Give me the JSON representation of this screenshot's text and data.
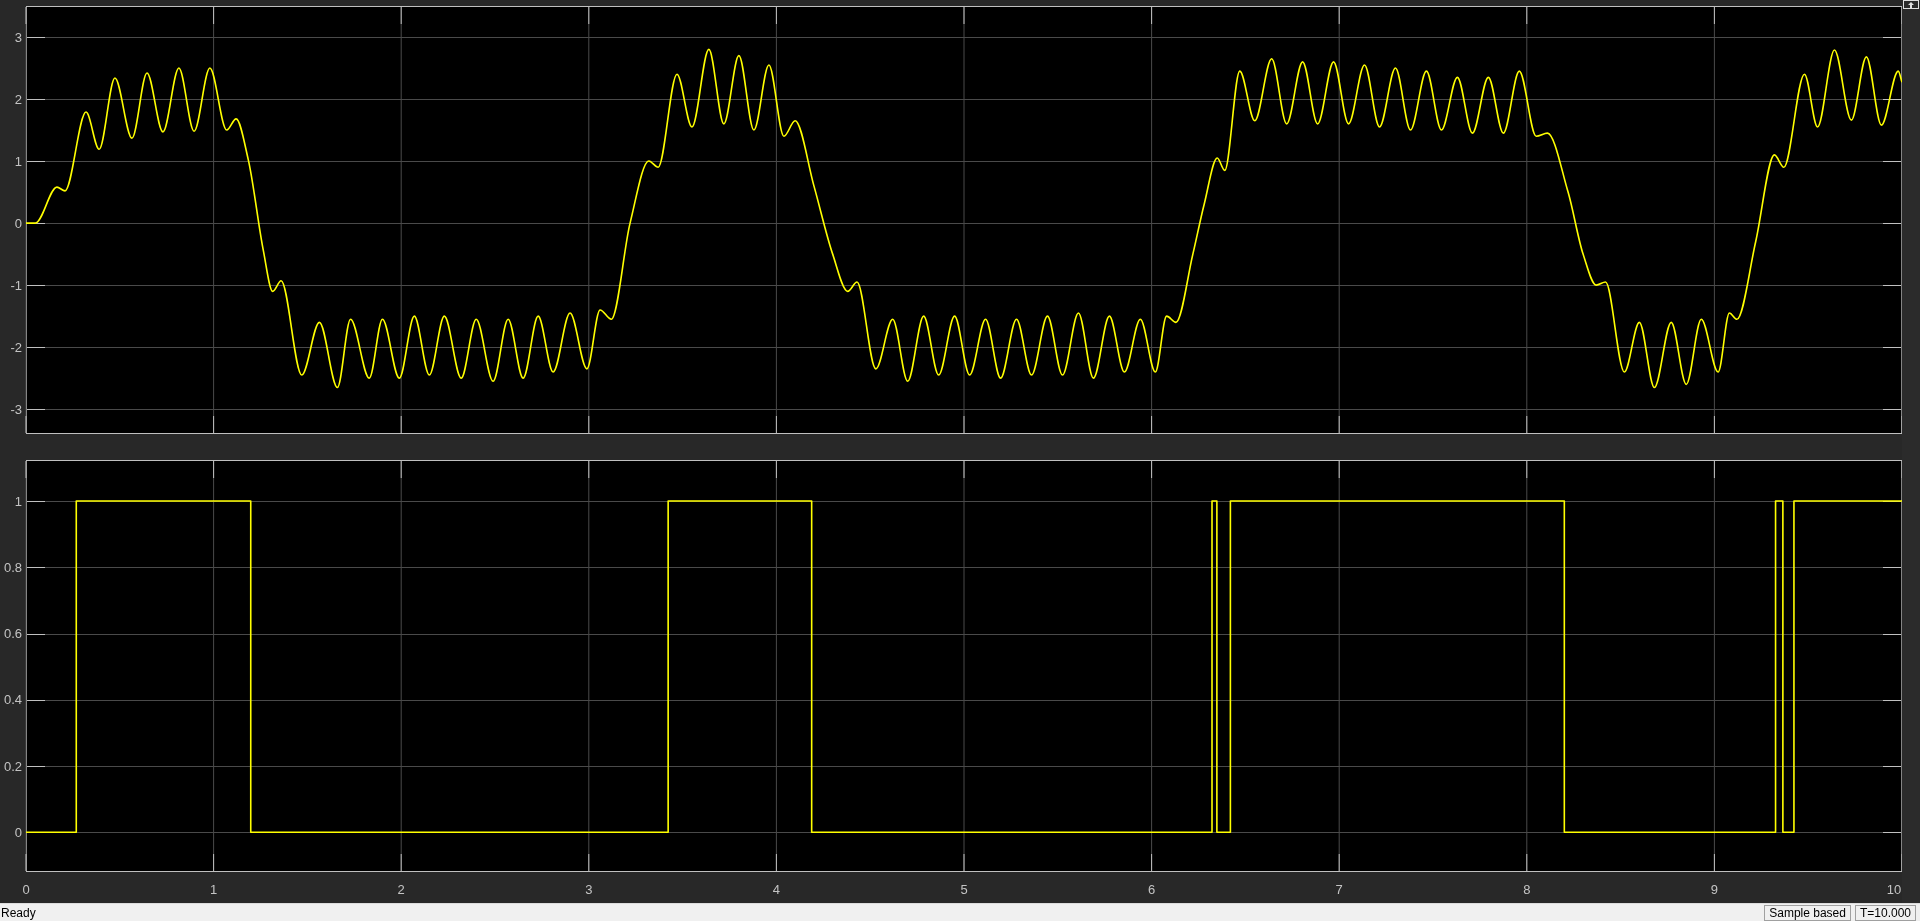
{
  "scope": {
    "plots": [
      {
        "chart_data": {
          "type": "line",
          "grid": true,
          "xlim": [
            0,
            10
          ],
          "ylim": [
            -3.4,
            3.5
          ],
          "yticks": [
            3,
            2,
            1,
            0,
            -1,
            -2,
            -3
          ],
          "x": [
            0,
            0.05,
            0.165,
            0.208,
            0.32,
            0.39,
            0.474,
            0.565,
            0.645,
            0.73,
            0.815,
            0.896,
            0.98,
            1.07,
            1.12,
            1.185,
            1.265,
            1.315,
            1.36,
            1.47,
            1.564,
            1.66,
            1.73,
            1.83,
            1.9,
            1.99,
            2.07,
            2.15,
            2.23,
            2.32,
            2.4,
            2.49,
            2.57,
            2.65,
            2.73,
            2.81,
            2.9,
            2.99,
            3.06,
            3.12,
            3.22,
            3.32,
            3.37,
            3.47,
            3.55,
            3.64,
            3.72,
            3.8,
            3.88,
            3.96,
            4.04,
            4.1,
            4.2,
            4.3,
            4.38,
            4.43,
            4.53,
            4.62,
            4.7,
            4.785,
            4.865,
            4.95,
            5.03,
            5.115,
            5.195,
            5.28,
            5.36,
            5.445,
            5.525,
            5.61,
            5.69,
            5.775,
            5.855,
            5.94,
            6.02,
            6.08,
            6.13,
            6.22,
            6.28,
            6.35,
            6.39,
            6.47,
            6.55,
            6.64,
            6.72,
            6.805,
            6.885,
            6.97,
            7.05,
            7.135,
            7.215,
            7.3,
            7.38,
            7.465,
            7.545,
            7.63,
            7.71,
            7.795,
            7.875,
            7.96,
            8.05,
            8.11,
            8.22,
            8.3,
            8.37,
            8.42,
            8.52,
            8.6,
            8.68,
            8.77,
            8.85,
            8.93,
            9.02,
            9.08,
            9.12,
            9.22,
            9.32,
            9.37,
            9.48,
            9.55,
            9.64,
            9.73,
            9.81,
            9.89,
            9.98,
            10
          ],
          "series": [
            {
              "color": "#ffff00",
              "values": [
                0,
                0,
                0.58,
                0.52,
                1.79,
                1.19,
                2.34,
                1.37,
                2.42,
                1.47,
                2.5,
                1.48,
                2.5,
                1.5,
                1.68,
                1.02,
                -0.44,
                -1.1,
                -0.93,
                -2.45,
                -1.6,
                -2.65,
                -1.55,
                -2.5,
                -1.55,
                -2.5,
                -1.5,
                -2.45,
                -1.5,
                -2.5,
                -1.55,
                -2.55,
                -1.55,
                -2.5,
                -1.5,
                -2.4,
                -1.45,
                -2.35,
                -1.4,
                -1.55,
                0,
                1.0,
                0.9,
                2.4,
                1.55,
                2.8,
                1.6,
                2.7,
                1.5,
                2.55,
                1.4,
                1.65,
                0.6,
                -0.5,
                -1.1,
                -0.95,
                -2.35,
                -1.55,
                -2.55,
                -1.5,
                -2.45,
                -1.5,
                -2.45,
                -1.55,
                -2.5,
                -1.55,
                -2.45,
                -1.5,
                -2.45,
                -1.45,
                -2.5,
                -1.5,
                -2.4,
                -1.55,
                -2.4,
                -1.5,
                -1.6,
                -0.5,
                0.3,
                1.05,
                0.85,
                2.45,
                1.65,
                2.65,
                1.6,
                2.6,
                1.6,
                2.6,
                1.6,
                2.55,
                1.55,
                2.5,
                1.5,
                2.45,
                1.5,
                2.35,
                1.45,
                2.35,
                1.45,
                2.45,
                1.4,
                1.45,
                0.5,
                -0.5,
                -1.0,
                -0.95,
                -2.4,
                -1.6,
                -2.65,
                -1.6,
                -2.6,
                -1.55,
                -2.4,
                -1.45,
                -1.55,
                -0.3,
                1.1,
                0.9,
                2.4,
                1.55,
                2.79,
                1.66,
                2.68,
                1.58,
                2.45,
                2.27
              ]
            }
          ]
        }
      },
      {
        "chart_data": {
          "type": "line",
          "grid": true,
          "xlim": [
            0,
            10
          ],
          "ylim": [
            -0.12,
            1.124
          ],
          "yticks": [
            {
              "value": 1,
              "label": "1"
            },
            {
              "value": 0.8,
              "label": "0.8"
            },
            {
              "value": 0.6,
              "label": "0.6"
            },
            {
              "value": 0.4,
              "label": "0.4"
            },
            {
              "value": 0.2,
              "label": "0.2"
            },
            {
              "value": 0,
              "label": "0"
            }
          ],
          "xticks": [
            0,
            1,
            2,
            3,
            4,
            5,
            6,
            7,
            8,
            9,
            10
          ],
          "x": [
            0,
            0.268,
            0.268,
            1.198,
            1.198,
            3.423,
            3.423,
            4.188,
            4.188,
            6.322,
            6.322,
            6.348,
            6.348,
            6.42,
            6.42,
            8.2,
            8.2,
            9.326,
            9.326,
            9.365,
            9.365,
            9.424,
            9.424,
            10
          ],
          "series": [
            {
              "color": "#ffff00",
              "values": [
                0,
                0,
                1,
                1,
                0,
                0,
                1,
                1,
                0,
                0,
                1,
                1,
                0,
                0,
                1,
                1,
                0,
                0,
                1,
                1,
                0,
                0,
                1,
                1
              ]
            }
          ]
        }
      }
    ]
  },
  "status_bar": {
    "status": "Ready",
    "mode": "Sample based",
    "time": "T=10.000"
  }
}
